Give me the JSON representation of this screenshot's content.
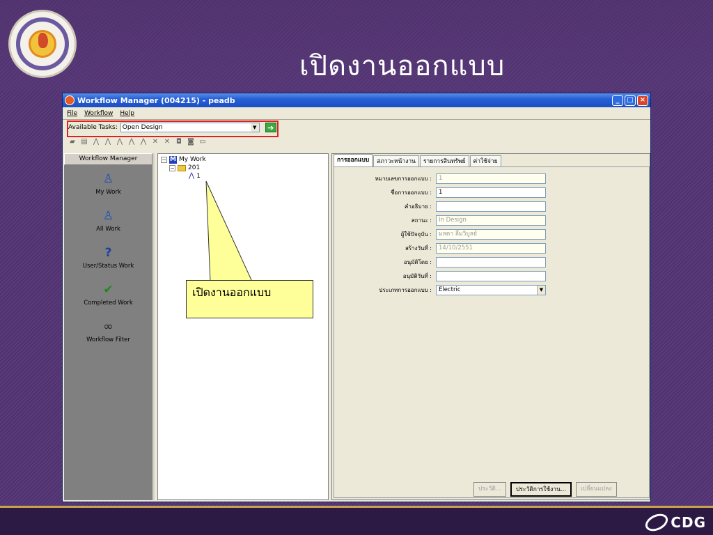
{
  "slide": {
    "title": "เปิดงานออกแบบ",
    "callout": "เปิดงานออกแบบ",
    "footer_logo": "CDG"
  },
  "window": {
    "title": "Workflow Manager (004215) - peadb",
    "menu": [
      "File",
      "Workflow",
      "Help"
    ],
    "available_tasks_label": "Available Tasks:",
    "available_tasks_value": "Open Design"
  },
  "left_panel": {
    "header": "Workflow Manager",
    "items": [
      {
        "label": "My Work",
        "icon": "person-folder-icon"
      },
      {
        "label": "All Work",
        "icon": "people-folder-icon"
      },
      {
        "label": "User/Status Work",
        "icon": "question-folder-icon"
      },
      {
        "label": "Completed Work",
        "icon": "checkmark-folder-icon"
      },
      {
        "label": "Workflow Filter",
        "icon": "binoculars-folder-icon"
      }
    ]
  },
  "tree": {
    "root": "My Work",
    "folder": "201",
    "item": "1"
  },
  "tabs": [
    "การออกแบบ",
    "สภาวะหน้างาน",
    "รายการสินทรัพย์",
    "ค่าใช้จ่าย"
  ],
  "form": {
    "fields": [
      {
        "label": "หมายเลขการออกแบบ :",
        "value": "1",
        "readonly": true
      },
      {
        "label": "ชื่อการออกแบบ :",
        "value": "1",
        "readonly": false
      },
      {
        "label": "คำอธิบาย :",
        "value": "",
        "readonly": false
      },
      {
        "label": "สถานะ :",
        "value": "In Design",
        "readonly": true
      },
      {
        "label": "ผู้ใช้ปัจจุบัน :",
        "value": "มลดา ลิ้มวิบูลย์",
        "readonly": true
      },
      {
        "label": "สร้างวันที่ :",
        "value": "14/10/2551",
        "readonly": true
      },
      {
        "label": "อนุมัติโดย :",
        "value": "",
        "readonly": false
      },
      {
        "label": "อนุมัติวันที่ :",
        "value": "",
        "readonly": false
      },
      {
        "label": "ประเภทการออกแบบ :",
        "value": "Electric",
        "readonly": false
      }
    ],
    "buttons": {
      "history": "ประวัติ...",
      "usage_history": "ประวัติการใช้งาน...",
      "change": "เปลี่ยนแปลง"
    }
  }
}
